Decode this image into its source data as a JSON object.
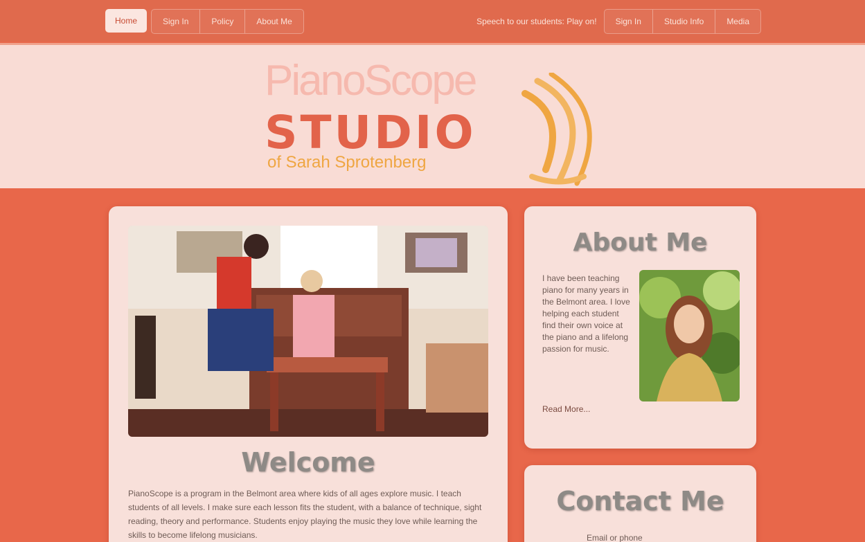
{
  "nav": {
    "left": [
      "Home",
      "Sign In",
      "Policy",
      "About Me"
    ],
    "tagline": "Speech to our students: Play on!",
    "right": [
      "Sign In",
      "Studio Info",
      "Media"
    ]
  },
  "logo": {
    "title": "PianoScope",
    "studio": "STUDIO",
    "subtitle": "of Sarah Sprotenberg"
  },
  "main": {
    "welcome_heading": "Welcome",
    "welcome_text": "PianoScope is a program in the Belmont area where kids of all ages explore music. I teach students of all levels. I make sure each lesson fits the student, with a balance of technique, sight reading, theory and performance. Students enjoy playing the music they love while learning the skills to become lifelong musicians."
  },
  "about": {
    "heading": "About Me",
    "text": "I have been teaching piano for many years in the Belmont area. I love helping each student find their own voice at the piano and a lifelong passion for music.",
    "read_more": "Read More..."
  },
  "contact": {
    "heading": "Contact Me",
    "line": "Email or phone"
  },
  "colors": {
    "page_bg": "#e8674a",
    "banner_bg": "#f9dcd5",
    "card_bg": "#f8e0da",
    "accent_orange": "#efa642"
  }
}
